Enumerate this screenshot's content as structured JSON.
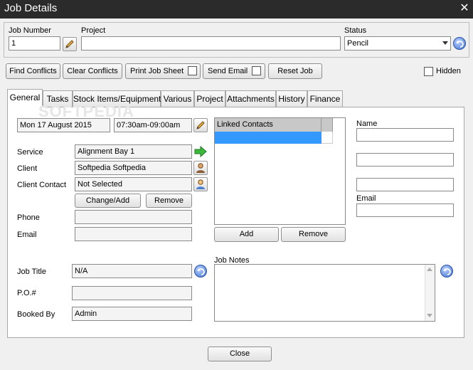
{
  "window": {
    "title": "Job Details"
  },
  "top": {
    "job_number_label": "Job Number",
    "job_number_value": "1",
    "project_label": "Project",
    "project_value": "",
    "status_label": "Status",
    "status_value": "Pencil"
  },
  "toolbar": {
    "find_conflicts": "Find Conflicts",
    "clear_conflicts": "Clear Conflicts",
    "print_job_sheet": "Print Job Sheet",
    "send_email": "Send Email",
    "reset_job": "Reset Job",
    "hidden_label": "Hidden"
  },
  "tabs": [
    {
      "label": "General"
    },
    {
      "label": "Tasks"
    },
    {
      "label": "Stock Items/Equipment"
    },
    {
      "label": "Various"
    },
    {
      "label": "Project"
    },
    {
      "label": "Attachments"
    },
    {
      "label": "History"
    },
    {
      "label": "Finance"
    }
  ],
  "general": {
    "date_value": "Mon 17 August 2015",
    "time_value": "07:30am-09:00am",
    "service_label": "Service",
    "service_value": "Alignment Bay 1",
    "client_label": "Client",
    "client_value": "Softpedia Softpedia",
    "client_contact_label": "Client Contact",
    "client_contact_value": "Not Selected",
    "change_add_button": "Change/Add",
    "remove_button": "Remove",
    "phone_label": "Phone",
    "phone_value": "",
    "email_label": "Email",
    "email_value": "",
    "job_title_label": "Job Title",
    "job_title_value": "N/A",
    "po_label": "P.O.#",
    "po_value": "",
    "booked_by_label": "Booked By",
    "booked_by_value": "Admin"
  },
  "linked_contacts": {
    "header": "Linked Contacts",
    "add_button": "Add",
    "remove_button": "Remove"
  },
  "contact_detail": {
    "name_label": "Name",
    "email_label": "Email"
  },
  "job_notes": {
    "label": "Job Notes",
    "value": ""
  },
  "footer": {
    "close_button": "Close"
  },
  "watermark": "SOFTPEDIA",
  "colors": {
    "titlebar": "#2b2b2b",
    "selection": "#3399ff",
    "accent_icon": "#3f6fcf"
  }
}
